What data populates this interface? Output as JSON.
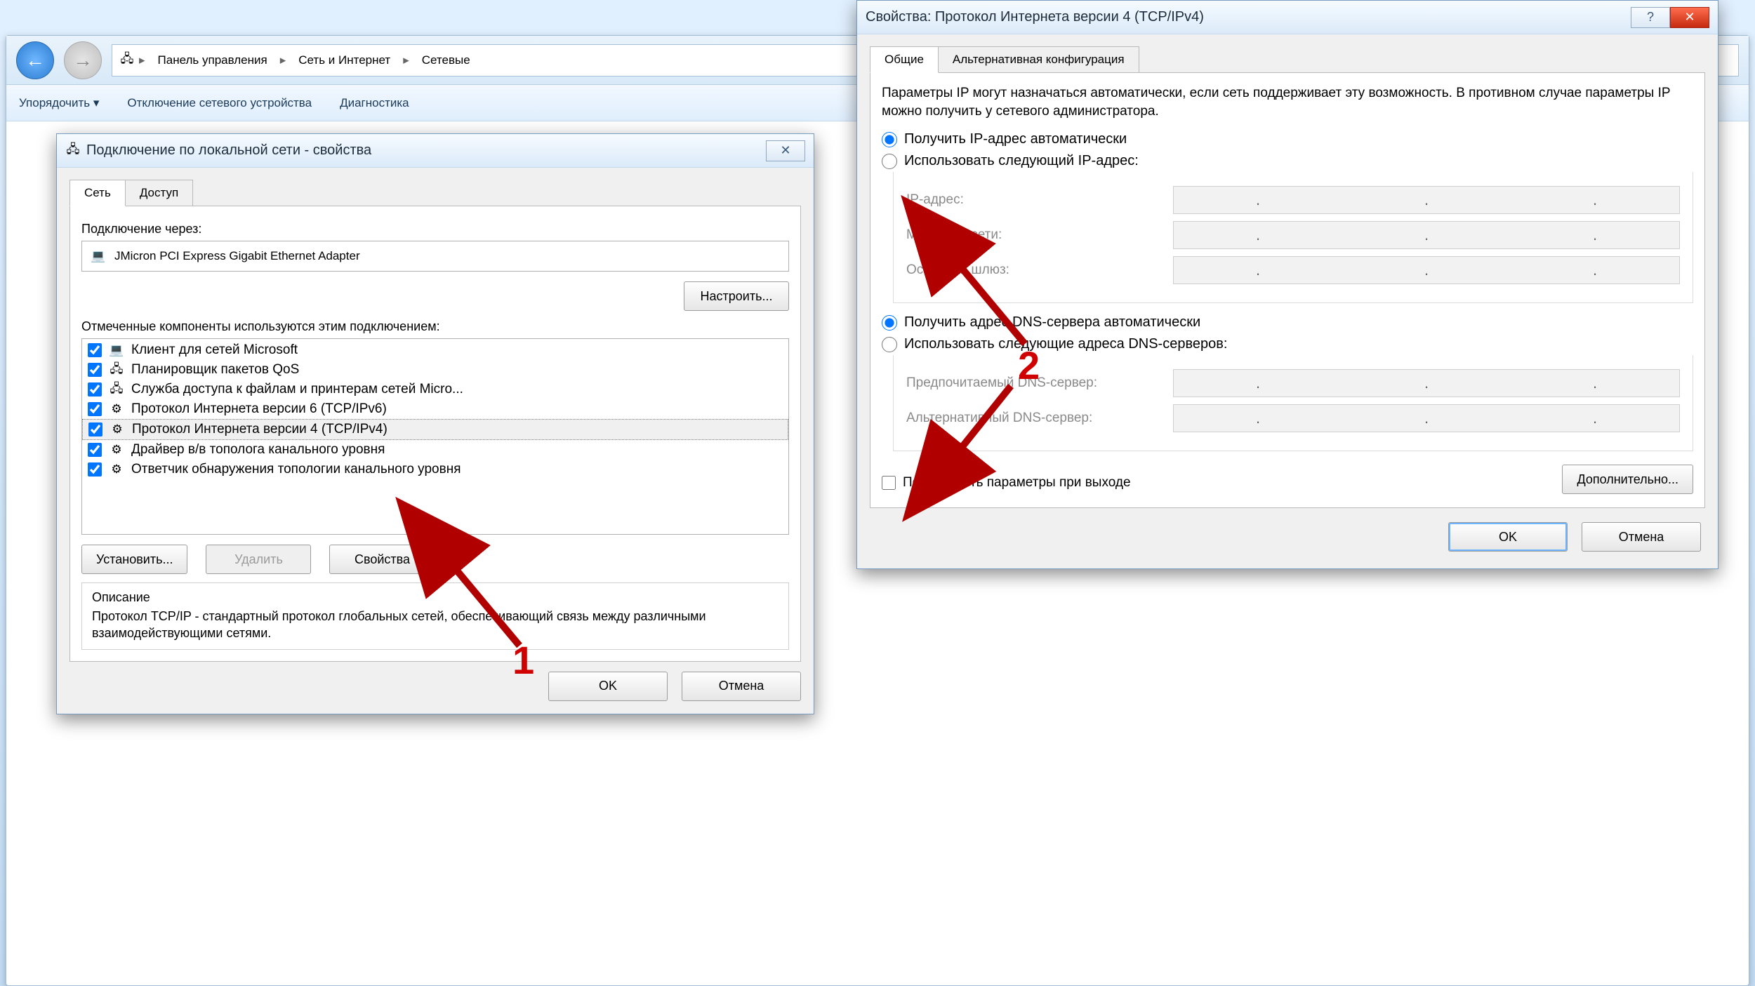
{
  "explorer": {
    "breadcrumb": [
      "Панель управления",
      "Сеть и Интернет",
      "Сетевые"
    ],
    "toolbar": {
      "organize": "Упорядочить ▾",
      "disable": "Отключение сетевого устройства",
      "diagnose": "Диагностика"
    }
  },
  "dlg_conn": {
    "title": "Подключение по локальной сети - свойства",
    "tabs": {
      "network": "Сеть",
      "access": "Доступ"
    },
    "connect_via_label": "Подключение через:",
    "adapter": "JMicron PCI Express Gigabit Ethernet Adapter",
    "configure_btn": "Настроить...",
    "components_label": "Отмеченные компоненты используются этим подключением:",
    "components": [
      {
        "checked": true,
        "icon": "client-icon",
        "label": "Клиент для сетей Microsoft"
      },
      {
        "checked": true,
        "icon": "scheduler-icon",
        "label": "Планировщик пакетов QoS"
      },
      {
        "checked": true,
        "icon": "fileshare-icon",
        "label": "Служба доступа к файлам и принтерам сетей Micro..."
      },
      {
        "checked": true,
        "icon": "protocol-icon",
        "label": "Протокол Интернета версии 6 (TCP/IPv6)"
      },
      {
        "checked": true,
        "icon": "protocol-icon",
        "label": "Протокол Интернета версии 4 (TCP/IPv4)",
        "selected": true
      },
      {
        "checked": true,
        "icon": "protocol-icon",
        "label": "Драйвер в/в тополога канального уровня"
      },
      {
        "checked": true,
        "icon": "protocol-icon",
        "label": "Ответчик обнаружения топологии канального уровня"
      }
    ],
    "install_btn": "Установить...",
    "uninstall_btn": "Удалить",
    "properties_btn": "Свойства",
    "desc_label": "Описание",
    "desc_text": "Протокол TCP/IP - стандартный протокол глобальных сетей, обеспечивающий связь между различными взаимодействующими сетями.",
    "ok": "OK",
    "cancel": "Отмена",
    "close_x": "✕"
  },
  "dlg_ipv4": {
    "title": "Свойства: Протокол Интернета версии 4 (TCP/IPv4)",
    "tabs": {
      "general": "Общие",
      "alt": "Альтернативная конфигурация"
    },
    "info": "Параметры IP могут назначаться автоматически, если сеть поддерживает эту возможность. В противном случае параметры IP можно получить у сетевого администратора.",
    "radio_ip_auto": "Получить IP-адрес автоматически",
    "radio_ip_manual": "Использовать следующий IP-адрес:",
    "ip_label": "IP-адрес:",
    "mask_label": "Маска подсети:",
    "gateway_label": "Основной шлюз:",
    "radio_dns_auto": "Получить адрес DNS-сервера автоматически",
    "radio_dns_manual": "Использовать следующие адреса DNS-серверов:",
    "dns1_label": "Предпочитаемый DNS-сервер:",
    "dns2_label": "Альтернативный DNS-сервер:",
    "confirm_exit": "Подтвердить параметры при выходе",
    "advanced_btn": "Дополнительно...",
    "ok": "OK",
    "cancel": "Отмена",
    "help": "?",
    "close_x": "✕"
  },
  "annotations": {
    "one": "1",
    "two": "2"
  }
}
